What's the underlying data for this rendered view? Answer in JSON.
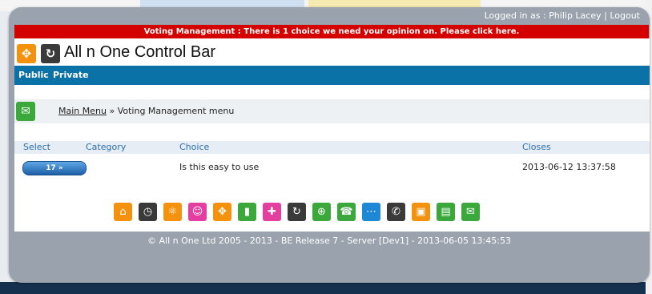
{
  "header": {
    "logged_in_label": "Logged in as : Philip Lacey",
    "separator": " | ",
    "logout_label": "Logout"
  },
  "alert": {
    "text": "Voting Management : There is 1 choice we need your opinion on.  Please click here."
  },
  "app": {
    "title": "All n One Control Bar"
  },
  "nav": {
    "items": [
      "Public",
      "Private"
    ]
  },
  "breadcrumb": {
    "link": "Main Menu",
    "separator": " » ",
    "current": "Voting Management menu"
  },
  "table": {
    "headers": [
      "Select",
      "Category",
      "Choice",
      "Closes"
    ],
    "rows": [
      {
        "select_label": "17 »",
        "category": "",
        "choice": "Is this easy to use",
        "closes": "2013-06-12 13:37:58"
      }
    ]
  },
  "toolbar_icons": [
    {
      "name": "home-icon",
      "color": "#f5920d",
      "glyph": "⌂"
    },
    {
      "name": "clock-icon",
      "color": "#3a3a3a",
      "glyph": "◷"
    },
    {
      "name": "atom-icon",
      "color": "#f5920d",
      "glyph": "⚛"
    },
    {
      "name": "people-icon",
      "color": "#e43fa0",
      "glyph": "☺"
    },
    {
      "name": "expand-icon",
      "color": "#f5920d",
      "glyph": "✥"
    },
    {
      "name": "chart-icon",
      "color": "#3aa83a",
      "glyph": "▮"
    },
    {
      "name": "puzzle-icon",
      "color": "#e43fa0",
      "glyph": "✚"
    },
    {
      "name": "refresh-icon",
      "color": "#3a3a3a",
      "glyph": "↻"
    },
    {
      "name": "globe-icon",
      "color": "#3aa83a",
      "glyph": "⊕"
    },
    {
      "name": "support-icon",
      "color": "#3aa83a",
      "glyph": "☎"
    },
    {
      "name": "network-icon",
      "color": "#1e88d6",
      "glyph": "⋯"
    },
    {
      "name": "phone-icon",
      "color": "#3a3a3a",
      "glyph": "✆"
    },
    {
      "name": "media-icon",
      "color": "#f5920d",
      "glyph": "▣"
    },
    {
      "name": "document-icon",
      "color": "#3aa83a",
      "glyph": "▤"
    },
    {
      "name": "mail-icon",
      "color": "#3aa83a",
      "glyph": "✉"
    }
  ],
  "footer": {
    "text": "© All n One Ltd 2005 - 2013 - BE Release 7 - Server [Dev1] - 2013-06-05 13:45:53"
  }
}
